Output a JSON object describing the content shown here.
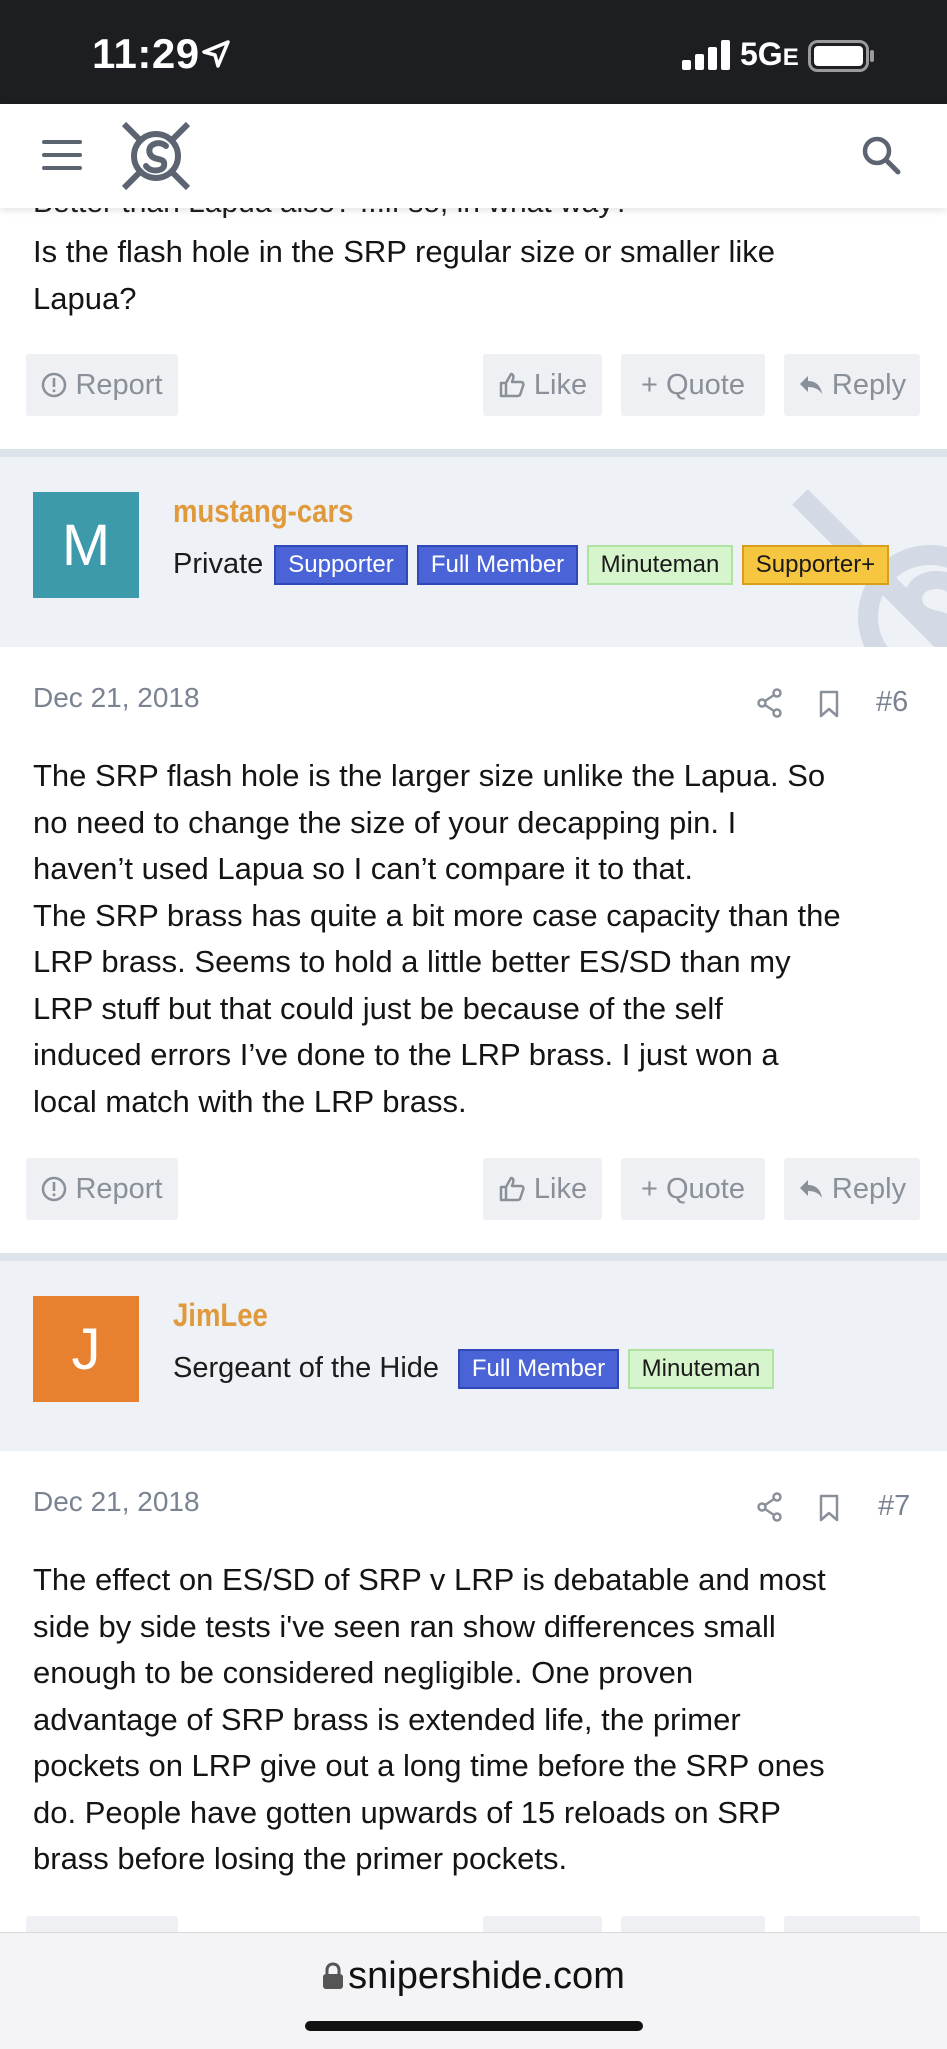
{
  "status": {
    "time": "11:29",
    "network": "5G",
    "network_sub": "E"
  },
  "site": {
    "url": "snipershide.com"
  },
  "actions": {
    "report": "Report",
    "like": "Like",
    "quote": "+ Quote",
    "reply": "Reply"
  },
  "prev_post": {
    "cut_line": "Better than Lapua also? ...if so, in what way?",
    "lines": [
      "Is the flash hole in the SRP regular size or smaller like",
      "Lapua?"
    ]
  },
  "posts": [
    {
      "username": "mustang-cars",
      "avatar_letter": "M",
      "avatar_color": "#3d9aab",
      "rank": "Private",
      "badges": [
        "Supporter",
        "Full Member",
        "Minuteman",
        "Supporter+"
      ],
      "date": "Dec 21, 2018",
      "number": "#6",
      "lines": [
        "The SRP flash hole is the larger size unlike the Lapua. So",
        "no need to change the size of your decapping pin. I",
        "haven’t used Lapua so I can’t compare it to that.",
        "The SRP brass has quite a bit more case capacity than the",
        "LRP brass. Seems to hold a little better ES/SD than my",
        "LRP stuff but that could just be because of the self",
        "induced errors I’ve done to the LRP brass. I just won a",
        "local match with the LRP brass."
      ]
    },
    {
      "username": "JimLee",
      "avatar_letter": "J",
      "avatar_color": "#e8812f",
      "rank": "Sergeant of the Hide",
      "badges": [
        "Full Member",
        "Minuteman"
      ],
      "date": "Dec 21, 2018",
      "number": "#7",
      "lines": [
        "The effect on ES/SD of SRP v LRP is debatable and most",
        "side by side tests i've seen ran show differences small",
        "enough to be considered negligible. One proven",
        "advantage of SRP brass is extended life, the primer",
        "pockets on LRP give out a long time before the SRP ones",
        "do. People have gotten upwards of 15 reloads on SRP",
        "brass before losing the primer pockets."
      ]
    }
  ],
  "icons": [
    "location-arrow-icon",
    "signal-icon",
    "battery-icon",
    "menu-icon",
    "site-logo",
    "search-icon",
    "report-icon",
    "thumbs-up-icon",
    "reply-arrow-icon",
    "share-icon",
    "bookmark-icon",
    "lock-icon"
  ]
}
